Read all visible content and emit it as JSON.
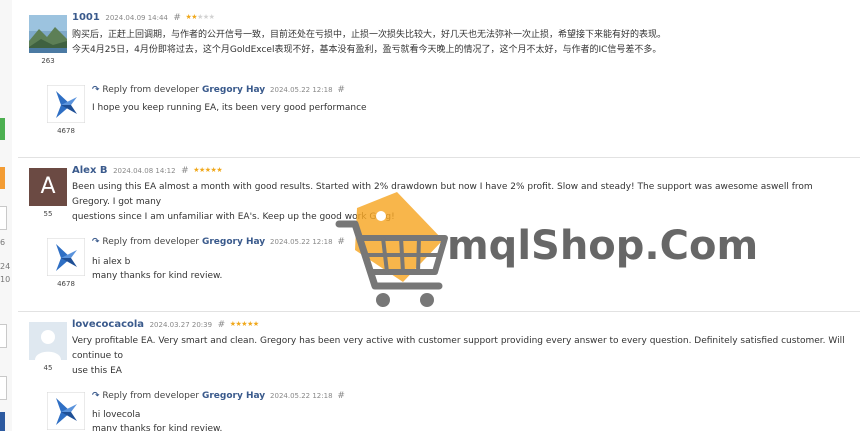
{
  "reviews": [
    {
      "author": "1001",
      "date": "2024.04.09 14:44",
      "hash": "#",
      "rating": 2,
      "avatar_count": "263",
      "lines": [
        "购买后，正赶上回调期，与作者的公开信号一致，目前还处在亏损中，止损一次损失比较大，好几天也无法弥补一次止损，希望接下来能有好的表现。",
        "今天4月25日，4月份即将过去，这个月GoldExcel表现不好，基本没有盈利，盈亏就看今天晚上的情况了，这个月不太好，与作者的IC信号差不多。"
      ],
      "reply": {
        "prefix": "Reply from developer",
        "developer": "Gregory Hay",
        "date": "2024.05.22 12:18",
        "hash": "#",
        "avatar_count": "4678",
        "lines": [
          "I hope you keep running EA, its been very good performance"
        ]
      }
    },
    {
      "author": "Alex B",
      "date": "2024.04.08 14:12",
      "hash": "#",
      "rating": 5,
      "avatar_letter": "A",
      "avatar_count": "55",
      "lines": [
        "Been using this EA almost a month with good results. Started with 2% drawdown but now I have 2% profit. Slow and steady! The support was awesome aswell from Gregory. I got many",
        "questions since I am unfamiliar with EA's. Keep up the good work Greg!"
      ],
      "reply": {
        "prefix": "Reply from developer",
        "developer": "Gregory Hay",
        "date": "2024.05.22 12:18",
        "hash": "#",
        "avatar_count": "4678",
        "lines": [
          "hi alex b",
          "many thanks for kind review."
        ]
      }
    },
    {
      "author": "lovecocacola",
      "date": "2024.03.27 20:39",
      "hash": "#",
      "rating": 5,
      "avatar_count": "45",
      "lines": [
        "Very profitable EA. Very smart and clean. Gregory has been very active with customer support providing every answer to every question. Definitely satisfied customer. Will continue to",
        "use this EA"
      ],
      "reply": {
        "prefix": "Reply from developer",
        "developer": "Gregory Hay",
        "date": "2024.05.22 12:18",
        "hash": "#",
        "lines": [
          "hi lovecola",
          "many thanks for kind review."
        ]
      }
    }
  ],
  "edge": {
    "numbers": [
      "6",
      "24",
      "10"
    ]
  },
  "watermark": {
    "text": "mqlShop.Com"
  },
  "colors": {
    "author": "#3a5a8c",
    "star_on": "#f0a81c",
    "star_off": "#d2d2d2",
    "tag": "#f6a623",
    "cart": "#777777",
    "alex_avatar": "#6b4a43",
    "dev_logo": "#2f6fc4",
    "edge_green": "#4caf50",
    "edge_orange": "#f39c34",
    "edge_blue": "#2d5aa0"
  },
  "icons": {
    "reply": "reply-arrow-icon",
    "star": "star-icon",
    "cart": "shopping-cart-icon",
    "tag": "price-tag-icon"
  }
}
